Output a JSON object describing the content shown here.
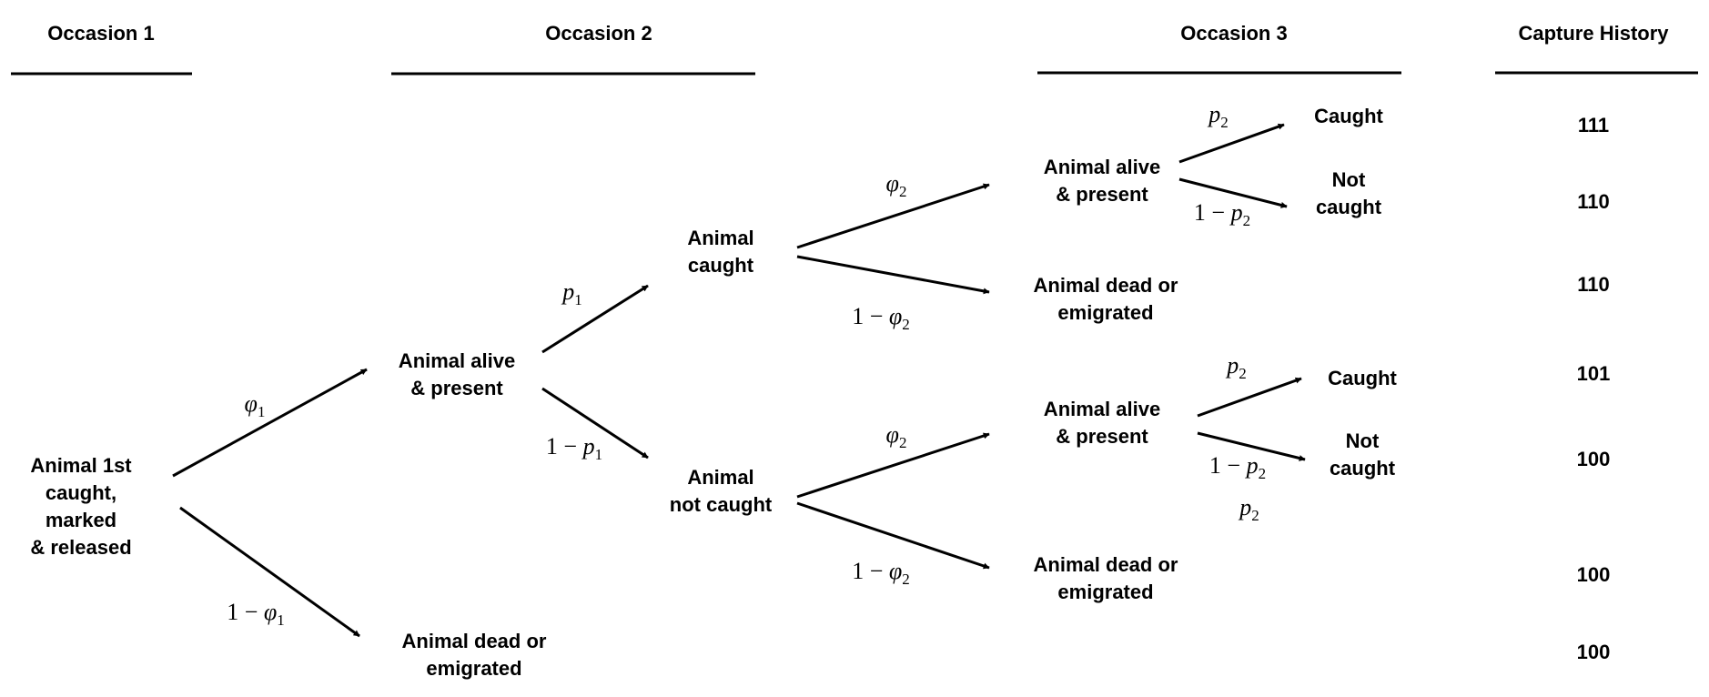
{
  "headers": {
    "occasion1": "Occasion 1",
    "occasion2": "Occasion 2",
    "occasion3": "Occasion 3",
    "capture_history": "Capture History"
  },
  "nodes": {
    "root": [
      "Animal 1st",
      "caught,",
      "marked",
      "& released"
    ],
    "occ2_alive": [
      "Animal alive",
      "& present"
    ],
    "occ2_dead": [
      "Animal dead or",
      "emigrated"
    ],
    "caught": [
      "Animal",
      "caught"
    ],
    "not_caught": [
      "Animal",
      "not caught"
    ],
    "occ3_alive_a": [
      "Animal alive",
      "& present"
    ],
    "occ3_dead_a": [
      "Animal dead or",
      "emigrated"
    ],
    "occ3_alive_b": [
      "Animal alive",
      "& present"
    ],
    "occ3_dead_b": [
      "Animal dead or",
      "emigrated"
    ],
    "caught_a": [
      "Caught"
    ],
    "notcaught_a": [
      "Not",
      "caught"
    ],
    "caught_b": [
      "Caught"
    ],
    "notcaught_b": [
      "Not",
      "caught"
    ]
  },
  "probabilities": {
    "phi1": {
      "prefix": "",
      "symbol": "φ",
      "sub": "1"
    },
    "one_minus_phi1": {
      "prefix": "1 − ",
      "symbol": "φ",
      "sub": "1"
    },
    "p1": {
      "prefix": "",
      "symbol": "p",
      "sub": "1"
    },
    "one_minus_p1": {
      "prefix": "1 − ",
      "symbol": "p",
      "sub": "1"
    },
    "phi2_a": {
      "prefix": "",
      "symbol": "φ",
      "sub": "2"
    },
    "one_minus_phi2_a": {
      "prefix": "1 − ",
      "symbol": "φ",
      "sub": "2"
    },
    "phi2_b": {
      "prefix": "",
      "symbol": "φ",
      "sub": "2"
    },
    "one_minus_phi2_b": {
      "prefix": "1 − ",
      "symbol": "φ",
      "sub": "2"
    },
    "p2_a": {
      "prefix": "",
      "symbol": "p",
      "sub": "2"
    },
    "one_minus_p2_a": {
      "prefix": "1 − ",
      "symbol": "p",
      "sub": "2"
    },
    "p2_b": {
      "prefix": "",
      "symbol": "p",
      "sub": "2"
    },
    "one_minus_p2_b": {
      "prefix": "1 − ",
      "symbol": "p",
      "sub": "2"
    },
    "p2_c": {
      "prefix": "",
      "symbol": "p",
      "sub": "2"
    }
  },
  "capture_histories": [
    "111",
    "110",
    "110",
    "101",
    "100",
    "100",
    "100"
  ]
}
